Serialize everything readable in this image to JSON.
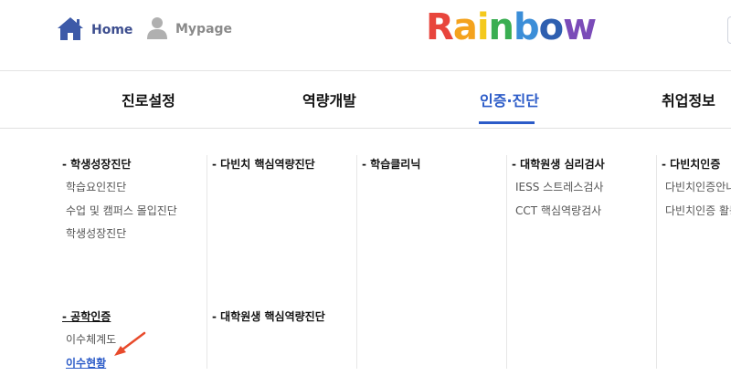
{
  "header": {
    "home_label": "Home",
    "mypage_label": "Mypage",
    "logo_letters": [
      "R",
      "a",
      "i",
      "n",
      "b",
      "o",
      "w"
    ],
    "logo_colors": [
      "#e8453c",
      "#f4a21d",
      "#f4c91d",
      "#3aae52",
      "#3b8ed8",
      "#2e5fb0",
      "#7a4bb8"
    ],
    "accent_color": "#2b5bc8"
  },
  "nav": {
    "items": [
      "진로설정",
      "역량개발",
      "인증·진단",
      "취업정보"
    ],
    "active_index": 2
  },
  "menu": {
    "col1_a": {
      "title": "- 학생성장진단",
      "items": [
        "학습요인진단",
        "수업 및 캠퍼스 몰입진단",
        "학생성장진단"
      ]
    },
    "col1_b": {
      "title": "- 공학인증",
      "items": [
        "이수체계도",
        "이수현황"
      ],
      "active_item": "이수현황"
    },
    "col2_a": {
      "title": "- 다빈치 핵심역량진단"
    },
    "col2_b": {
      "title": "- 대학원생 핵심역량진단"
    },
    "col3_a": {
      "title": "- 학습클리닉"
    },
    "col4_a": {
      "title": "- 대학원생 심리검사",
      "items": [
        "IESS 스트레스검사",
        "CCT 핵심역량검사"
      ]
    },
    "col5_a": {
      "title": "- 다빈치인증",
      "items": [
        "다빈치인증안내",
        "다빈치인증 활동"
      ]
    }
  },
  "annotation": {
    "arrow_color": "#e84a2b"
  }
}
